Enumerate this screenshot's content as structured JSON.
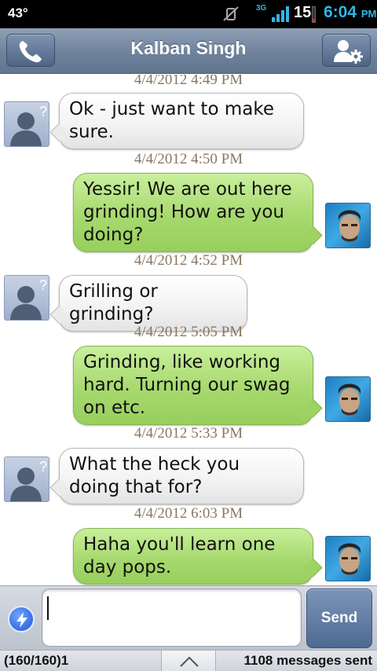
{
  "status_bar": {
    "temperature": "43°",
    "network": "3G",
    "battery": "15",
    "time": "6:04",
    "ampm": "PM"
  },
  "header": {
    "title": "Kalban Singh",
    "call_icon": "phone-icon",
    "contact_icon": "contact-settings-icon"
  },
  "messages": [
    {
      "timestamp": "4/4/2012 4:49 PM"
    },
    {
      "timestamp": "",
      "direction": "in",
      "text": "Ok - just want to make sure."
    },
    {
      "timestamp": "4/4/2012 4:50 PM"
    },
    {
      "direction": "out",
      "text": "Yessir! We are out here grinding! How are you doing?"
    },
    {
      "timestamp": "4/4/2012 4:52 PM"
    },
    {
      "direction": "in",
      "text": "Grilling or grinding?"
    },
    {
      "timestamp": "4/4/2012 5:05 PM"
    },
    {
      "direction": "out",
      "text": "Grinding, like working hard. Turning our swag on etc."
    },
    {
      "timestamp": "4/4/2012 5:33 PM"
    },
    {
      "direction": "in",
      "text": "What the heck you doing that for?"
    },
    {
      "timestamp": "4/4/2012 6:03 PM"
    },
    {
      "direction": "out",
      "text": "Haha you'll learn one day pops."
    }
  ],
  "composer": {
    "input_value": "",
    "send_label": "Send"
  },
  "bottom_bar": {
    "char_counter": "(160/160)1",
    "messages_sent": "1108 messages sent"
  },
  "colors": {
    "incoming_bubble": "#f2f2f2",
    "outgoing_bubble": "#a7d96e",
    "header": "#6f829c",
    "accent_blue": "#33b5e5"
  }
}
